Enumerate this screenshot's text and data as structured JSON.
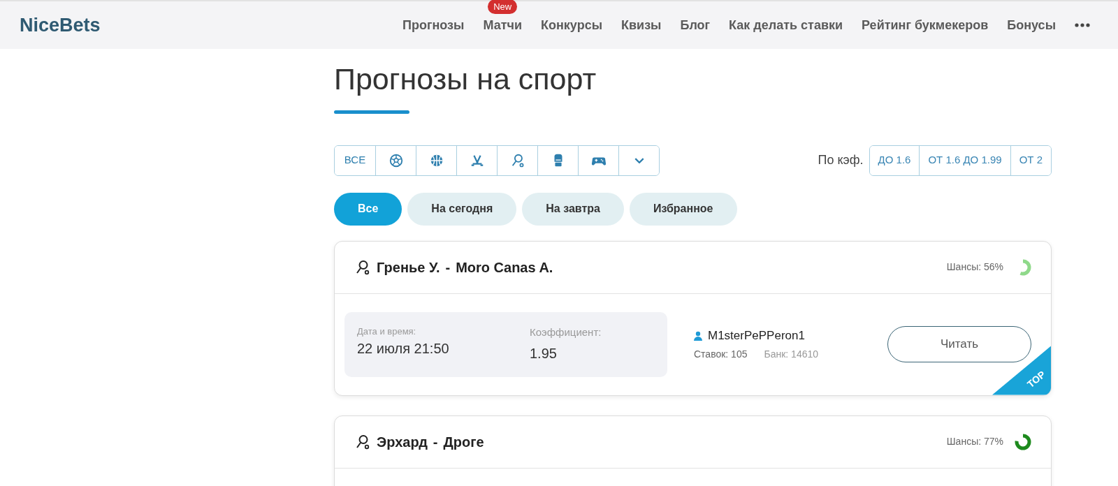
{
  "brand": "NiceBets",
  "nav": [
    {
      "label": "Прогнозы"
    },
    {
      "label": "Матчи",
      "badge": "New"
    },
    {
      "label": "Конкурсы"
    },
    {
      "label": "Квизы"
    },
    {
      "label": "Блог"
    },
    {
      "label": "Как делать ставки"
    },
    {
      "label": "Рейтинг букмекеров"
    },
    {
      "label": "Бонусы"
    }
  ],
  "title": "Прогнозы на спорт",
  "sports": [
    {
      "kind": "all",
      "label": "ВСЕ"
    },
    {
      "kind": "football"
    },
    {
      "kind": "basketball"
    },
    {
      "kind": "hockey"
    },
    {
      "kind": "tennis"
    },
    {
      "kind": "boxing"
    },
    {
      "kind": "esports"
    },
    {
      "kind": "more"
    }
  ],
  "odds_filter": {
    "label": "По кэф.",
    "options": [
      "ДО 1.6",
      "ОТ 1.6 ДО 1.99",
      "ОТ 2"
    ]
  },
  "tabs": [
    {
      "label": "Все",
      "selected": true
    },
    {
      "label": "На сегодня",
      "selected": false
    },
    {
      "label": "На завтра",
      "selected": false
    },
    {
      "label": "Избранное",
      "selected": false
    }
  ],
  "predictions": [
    {
      "kind": "tennis",
      "team1": "Гренье У.",
      "separator": "-",
      "team2": "Moro Canas A.",
      "chance": "Шансы: 56%",
      "level": 0.56,
      "color": "#8fd98a",
      "date_label": "Дата и время:",
      "date": "22 июля 21:50",
      "odds_label": "Коэффициент:",
      "odds": "1.95",
      "author": "M1sterPePPeron1",
      "bets": "Ставок: 105",
      "bank": "Банк: 14610",
      "button": "Читать",
      "top": "TOP"
    },
    {
      "kind": "tennis",
      "team1": "Эрхард",
      "separator": "-",
      "team2": "Дроге",
      "chance": "Шансы: 77%",
      "level": 0.77,
      "color": "#1d8a1d"
    }
  ]
}
